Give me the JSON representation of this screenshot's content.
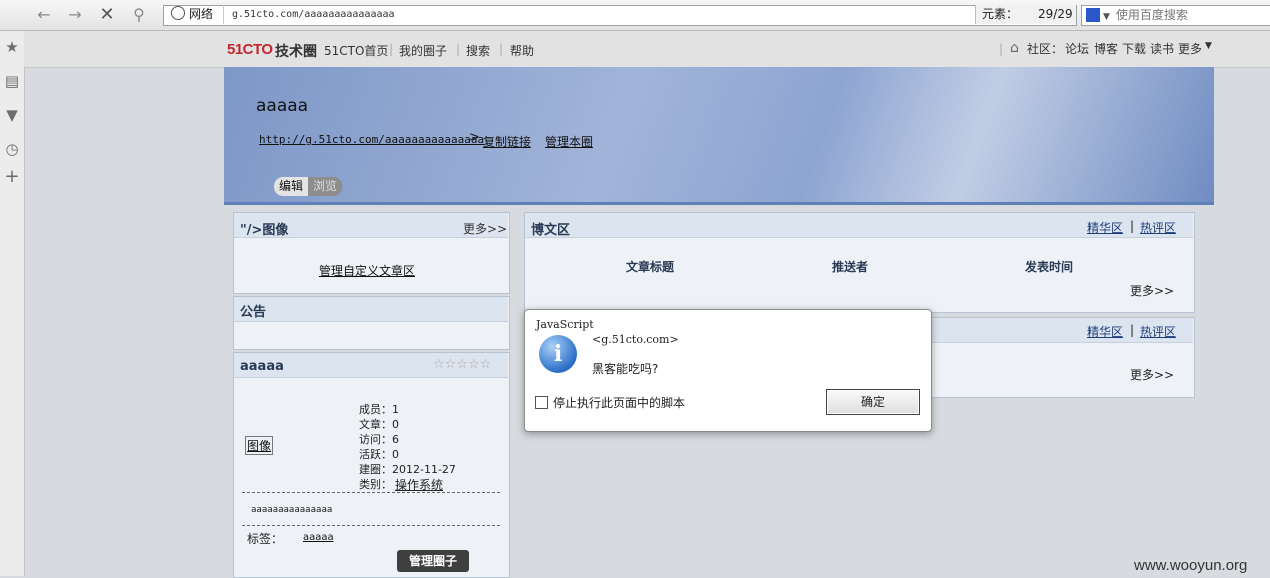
{
  "browser": {
    "zone_label": "网络",
    "url": "g.51cto.com/aaaaaaaaaaaaaaa",
    "elements_label": "元素：",
    "elements_count": "29/29",
    "search_placeholder": "使用百度搜索"
  },
  "site": {
    "logo_a": "51CTO",
    "logo_b": "技术圈",
    "nav": [
      "51CTO首页",
      "我的圈子",
      "搜索",
      "帮助"
    ],
    "community_label": "社区：",
    "community_links": [
      "论坛",
      "博客",
      "下载",
      "读书",
      "更多"
    ]
  },
  "circle": {
    "name": "aaaaa",
    "url": "http://g.51cto.com/aaaaaaaaaaaaaaa",
    "copy_link": "复制链接",
    "manage_circle": "管理本圈",
    "tab_edit": "编辑",
    "tab_browse": "浏览"
  },
  "left": {
    "avatar_title": "\"/>图像",
    "more": "更多>>",
    "manage_custom": "管理自定义文章区",
    "notice_title": "公告",
    "info_title": "aaaaa",
    "rating_stars": 0,
    "avatar_link": "图像",
    "stats": {
      "members": "成员：1",
      "articles": "文章：0",
      "visits": "访问：6",
      "active": "活跃：0",
      "created": "建圈：2012-11-27",
      "category_label": "类别：",
      "category_value": "操作系统"
    },
    "desc": "aaaaaaaaaaaaaaa",
    "tags_label": "标签：",
    "tag": "aaaaa",
    "manage_button": "管理圈子"
  },
  "right": {
    "blog_title": "博文区",
    "featured": "精华区",
    "hot": "热评区",
    "col_title": "文章标题",
    "col_pusher": "推送者",
    "col_time": "发表时间",
    "more": "更多>>",
    "divider": "|"
  },
  "dialog": {
    "title": "JavaScript",
    "origin": "<g.51cto.com>",
    "message": "黑客能吃吗?",
    "checkbox_label": "停止执行此页面中的脚本",
    "ok": "确定"
  },
  "watermark": "www.wooyun.org"
}
